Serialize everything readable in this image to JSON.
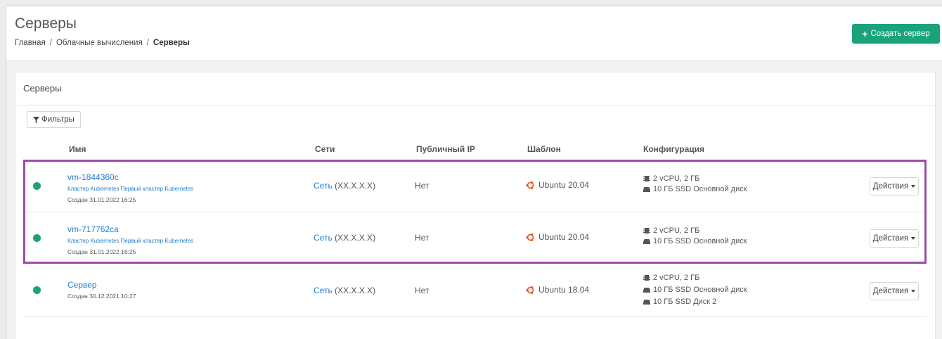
{
  "header": {
    "title": "Серверы",
    "breadcrumb": [
      "Главная",
      "Облачные вычисления",
      "Серверы"
    ],
    "breadcrumb_sep": "/",
    "create_button": "Создать сервер",
    "create_icon": "+"
  },
  "card": {
    "title": "Серверы",
    "filter_button": "Фильтры"
  },
  "table": {
    "columns": [
      "Имя",
      "Сети",
      "Публичный IP",
      "Шаблон",
      "Конфигурация"
    ],
    "rows": [
      {
        "name": "vm-1844360c",
        "cluster": "Кластер Kubernetes Первый кластер Kubernetes",
        "created": "Создан 31.01.2022 16:25",
        "network_link": "Сеть",
        "network_ip": "(XX.X.X.X)",
        "public_ip": "Нет",
        "template": "Ubuntu 20.04",
        "config": [
          "2 vCPU, 2 ГБ",
          "10 ГБ SSD Основной диск"
        ],
        "actions": "Действия",
        "status_color": "#1aa37a"
      },
      {
        "name": "vm-717762ca",
        "cluster": "Кластер Kubernetes Первый кластер Kubernetes",
        "created": "Создан 31.01.2022 16:25",
        "network_link": "Сеть",
        "network_ip": "(XX.X.X.X)",
        "public_ip": "Нет",
        "template": "Ubuntu 20.04",
        "config": [
          "2 vCPU, 2 ГБ",
          "10 ГБ SSD Основной диск"
        ],
        "actions": "Действия",
        "status_color": "#1aa37a"
      },
      {
        "name": "Сервер",
        "created": "Создан 30.12.2021 10:27",
        "network_link": "Сеть",
        "network_ip": "(XX.X.X.X)",
        "public_ip": "Нет",
        "template": "Ubuntu 18.04",
        "config": [
          "2 vCPU, 2 ГБ",
          "10 ГБ SSD Основной диск",
          "10 ГБ SSD Диск 2"
        ],
        "actions": "Действия",
        "status_color": "#1aa37a"
      }
    ]
  },
  "colors": {
    "accent": "#1aa37a",
    "link": "#1f7ecf",
    "highlight": "#9c4da5",
    "ubuntu": "#e95420"
  }
}
